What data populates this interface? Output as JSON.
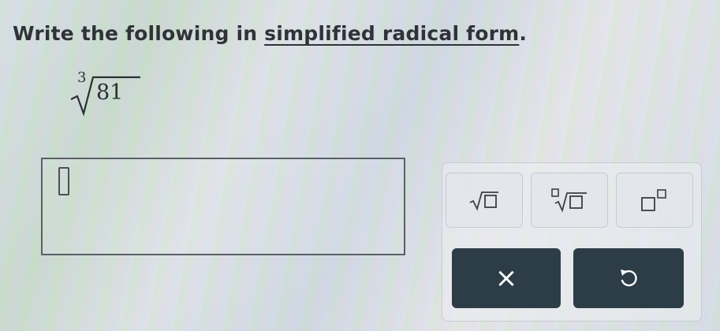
{
  "question": {
    "prefix": "Write the following in ",
    "emphasis": "simplified radical form",
    "suffix": "."
  },
  "expression": {
    "index": "3",
    "radicand": "81"
  },
  "answer": {
    "value": ""
  },
  "keypad": {
    "keys": [
      {
        "name": "square-root-key",
        "icon": "square-root-template-icon"
      },
      {
        "name": "nth-root-key",
        "icon": "nth-root-template-icon"
      },
      {
        "name": "exponent-key",
        "icon": "exponent-template-icon"
      }
    ],
    "actions": {
      "clear_label": "×",
      "undo_icon": "undo-icon"
    }
  },
  "colors": {
    "text": "#2f3338",
    "action_button": "#2d3d47",
    "box_border": "#5a5f66"
  }
}
